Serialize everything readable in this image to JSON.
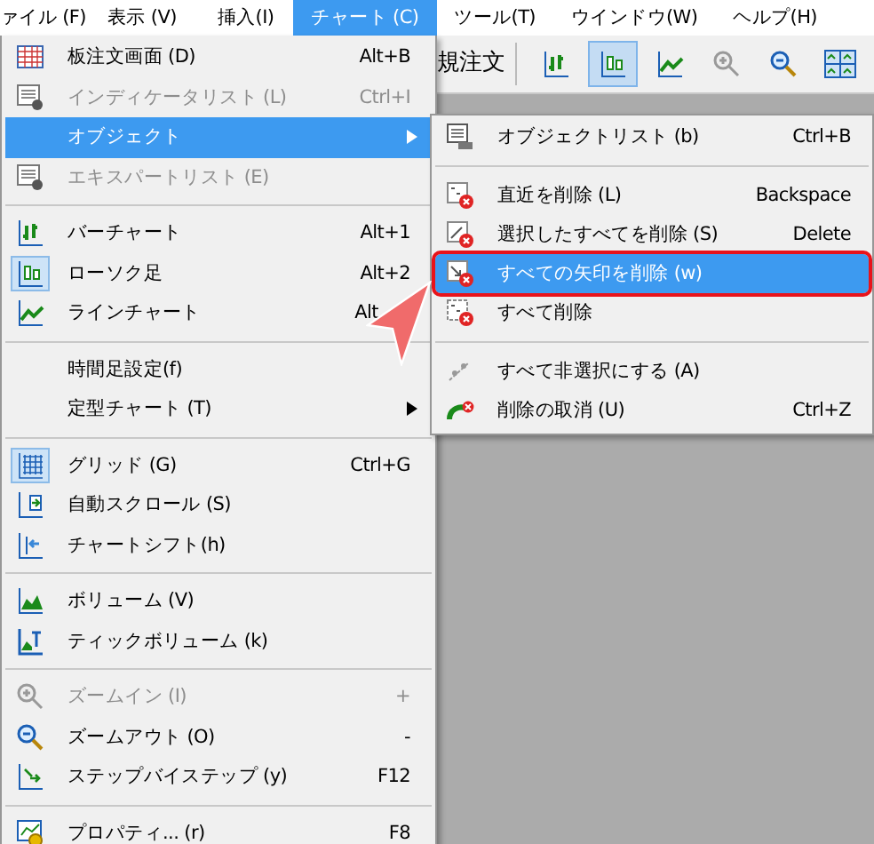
{
  "menubar": [
    {
      "label": "ァイル (F)",
      "selected": false
    },
    {
      "label": "表示 (V)",
      "selected": false
    },
    {
      "label": "挿入(I)",
      "selected": false
    },
    {
      "label": "チャート (C)",
      "selected": true
    },
    {
      "label": "ツール(T)",
      "selected": false
    },
    {
      "label": "ウインドウ(W)",
      "selected": false
    },
    {
      "label": "ヘルプ(H)",
      "selected": false
    }
  ],
  "toolbar": {
    "text": "規注文",
    "buttons": [
      {
        "pressed": false
      },
      {
        "pressed": true
      },
      {
        "pressed": false
      },
      {
        "pressed": false
      },
      {
        "pressed": false
      },
      {
        "pressed": false
      }
    ]
  },
  "menu": [
    {
      "kind": "item",
      "label": "板注文画面 (D)",
      "shortcut": "Alt+B",
      "disabled": false,
      "checked": false,
      "selected": false
    },
    {
      "kind": "item",
      "label": "インディケータリスト (L)",
      "shortcut": "Ctrl+I",
      "disabled": true,
      "checked": false,
      "selected": false
    },
    {
      "kind": "item",
      "label": "オブジェクト",
      "disabled": false,
      "checked": false,
      "selected": true,
      "submenu": true
    },
    {
      "kind": "item",
      "label": "エキスパートリスト (E)",
      "disabled": true,
      "checked": false,
      "selected": false
    },
    {
      "kind": "separator"
    },
    {
      "kind": "item",
      "label": "バーチャート",
      "shortcut": "Alt+1",
      "disabled": false,
      "checked": false,
      "selected": false
    },
    {
      "kind": "item",
      "label": "ローソク足",
      "shortcut": "Alt+2",
      "disabled": false,
      "checked": true,
      "selected": false
    },
    {
      "kind": "item",
      "label": "ラインチャート",
      "shortcut": "Alt",
      "disabled": false,
      "checked": false,
      "selected": false
    },
    {
      "kind": "separator"
    },
    {
      "kind": "item",
      "label": "時間足設定(f)",
      "disabled": false,
      "checked": false,
      "selected": false
    },
    {
      "kind": "item",
      "label": "定型チャート (T)",
      "disabled": false,
      "checked": false,
      "selected": false,
      "submenu": true
    },
    {
      "kind": "separator"
    },
    {
      "kind": "item",
      "label": "グリッド (G)",
      "shortcut": "Ctrl+G",
      "disabled": false,
      "checked": true,
      "selected": false
    },
    {
      "kind": "item",
      "label": "自動スクロール (S)",
      "disabled": false,
      "checked": false,
      "selected": false
    },
    {
      "kind": "item",
      "label": "チャートシフト(h)",
      "disabled": false,
      "checked": false,
      "selected": false
    },
    {
      "kind": "separator"
    },
    {
      "kind": "item",
      "label": "ボリューム (V)",
      "disabled": false,
      "checked": false,
      "selected": false
    },
    {
      "kind": "item",
      "label": "ティックボリューム (k)",
      "disabled": false,
      "checked": false,
      "selected": false
    },
    {
      "kind": "separator"
    },
    {
      "kind": "item",
      "label": "ズームイン (I)",
      "shortcut": "+",
      "disabled": true,
      "checked": false,
      "selected": false
    },
    {
      "kind": "item",
      "label": "ズームアウト (O)",
      "shortcut": "-",
      "disabled": false,
      "checked": false,
      "selected": false
    },
    {
      "kind": "item",
      "label": "ステップバイステップ (y)",
      "shortcut": "F12",
      "disabled": false,
      "checked": false,
      "selected": false
    },
    {
      "kind": "separator"
    },
    {
      "kind": "item",
      "label": "プロパティ... (r)",
      "shortcut": "F8",
      "disabled": false,
      "checked": false,
      "selected": false
    }
  ],
  "submenu": [
    {
      "kind": "item",
      "label": "オブジェクトリスト (b)",
      "shortcut": "Ctrl+B",
      "selected": false
    },
    {
      "kind": "separator"
    },
    {
      "kind": "item",
      "label": "直近を削除 (L)",
      "shortcut": "Backspace",
      "selected": false
    },
    {
      "kind": "item",
      "label": "選択したすべてを削除 (S)",
      "shortcut": "Delete",
      "selected": false
    },
    {
      "kind": "item",
      "label": "すべての矢印を削除 (w)",
      "selected": true
    },
    {
      "kind": "item",
      "label": "すべて削除",
      "selected": false
    },
    {
      "kind": "separator"
    },
    {
      "kind": "item",
      "label": "すべて非選択にする (A)",
      "selected": false
    },
    {
      "kind": "item",
      "label": "削除の取消 (U)",
      "shortcut": "Ctrl+Z",
      "selected": false
    }
  ]
}
